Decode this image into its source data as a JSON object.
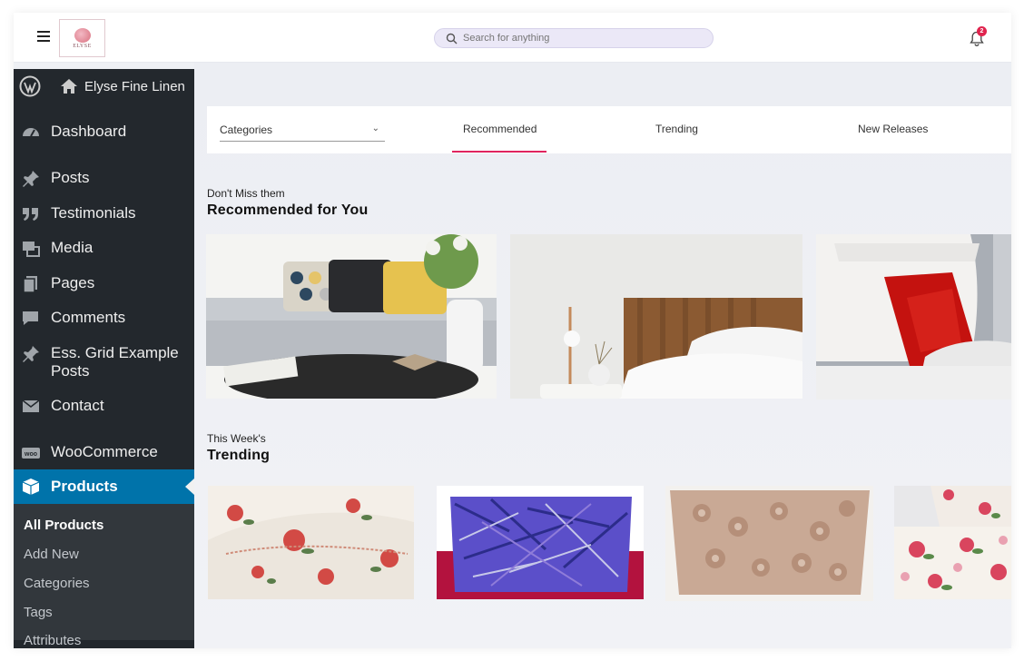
{
  "topbar": {
    "logo_text": "ELYSE",
    "search_placeholder": "Search for anything",
    "notification_count": "2"
  },
  "sidebar": {
    "site_name": "Elyse Fine Linen",
    "items": [
      {
        "label": "Dashboard",
        "icon": "dashboard-icon"
      },
      {
        "label": "Posts",
        "icon": "pin-icon"
      },
      {
        "label": "Testimonials",
        "icon": "quote-icon"
      },
      {
        "label": "Media",
        "icon": "media-icon"
      },
      {
        "label": "Pages",
        "icon": "pages-icon"
      },
      {
        "label": "Comments",
        "icon": "comment-icon"
      },
      {
        "label": "Ess. Grid Example Posts",
        "icon": "pin-icon"
      },
      {
        "label": "Contact",
        "icon": "mail-icon"
      },
      {
        "label": "WooCommerce",
        "icon": "woo-icon"
      },
      {
        "label": "Products",
        "icon": "box-icon"
      }
    ],
    "sub_items": [
      "All Products",
      "Add New",
      "Categories",
      "Tags",
      "Attributes"
    ]
  },
  "filters": {
    "categories_label": "Categories",
    "tabs": [
      "Recommended",
      "Trending",
      "New Releases"
    ],
    "active_tab": "Recommended"
  },
  "sections": {
    "recommended_kicker": "Don't Miss them",
    "recommended_title": "Recommended for You",
    "trending_kicker": "This Week's",
    "trending_title": "Trending"
  },
  "colors": {
    "accent": "#e0245e",
    "sidebar_bg": "#23282d",
    "sidebar_active": "#0073aa",
    "search_bg": "#ebe8f7"
  }
}
